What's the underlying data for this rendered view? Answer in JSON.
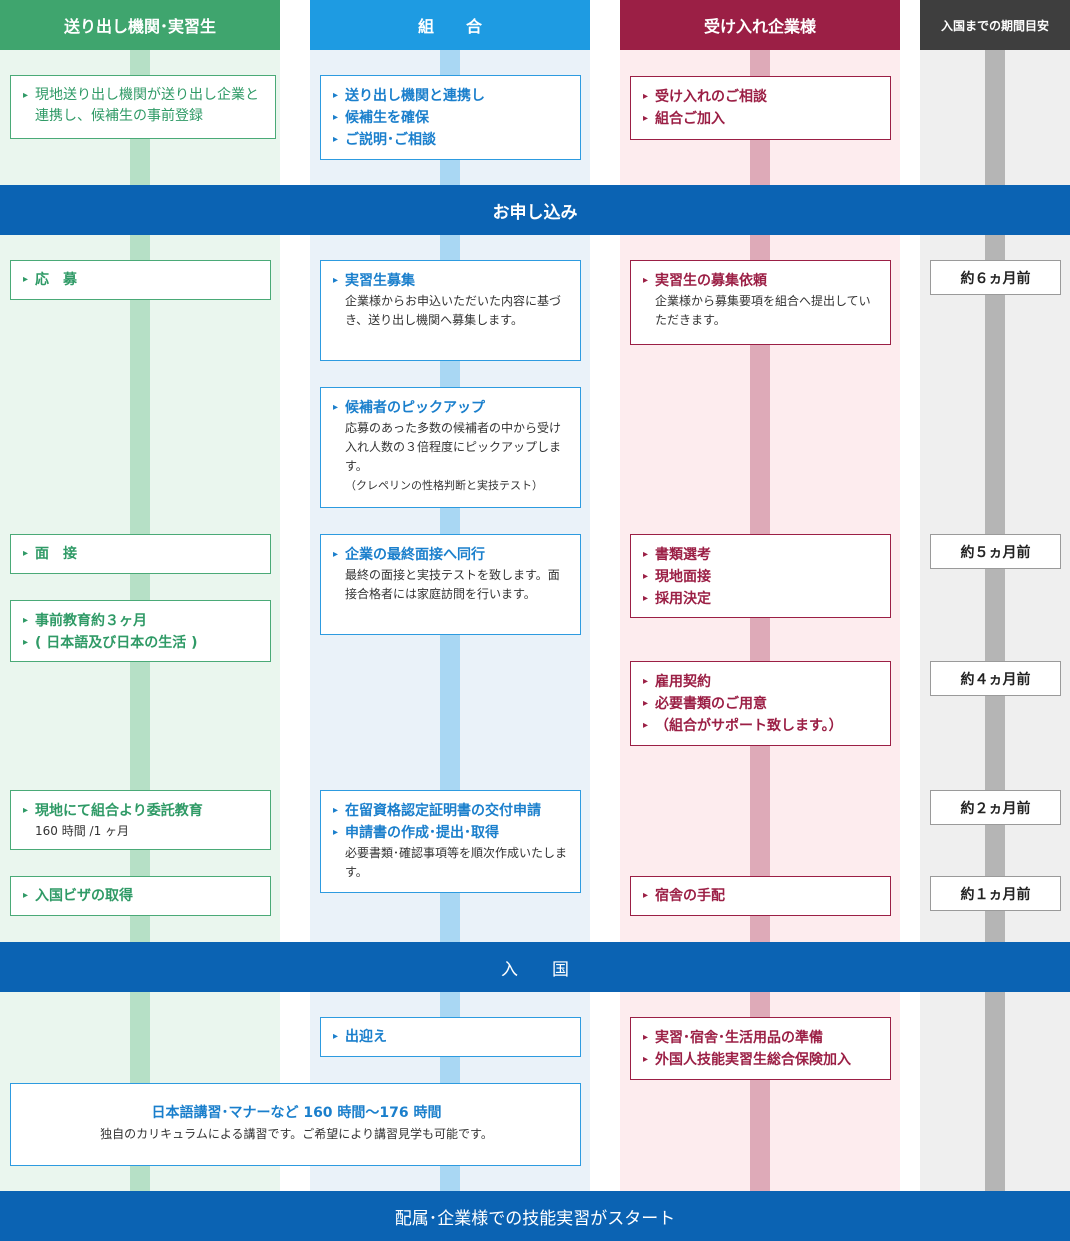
{
  "headers": {
    "sending": "送り出し機関･実習生",
    "union": "組　　合",
    "company": "受け入れ企業様",
    "period": "入国までの期間目安"
  },
  "colors": {
    "sending_header": "#3fa56e",
    "union_header": "#1e9be2",
    "company_header": "#9b1f45",
    "period_header": "#3e3e3e",
    "band": "#0b63b3"
  },
  "bands": {
    "apply": "お申し込み",
    "entry": "入　　国",
    "start": "配属･企業様での技能実習がスタート"
  },
  "sending": {
    "register": "現地送り出し機関が送り出し企業と連携し、候補生の事前登録",
    "apply": "応　募",
    "interview": "面　接",
    "pre_edu": "事前教育約３ヶ月",
    "pre_edu_sub": "( 日本語及び日本の生活 )",
    "local_edu": "現地にて組合より委託教育",
    "local_edu_sub": "160 時間 /1 ヶ月",
    "visa": "入国ビザの取得"
  },
  "union": {
    "pre1": "送り出し機関と連携し",
    "pre1b": "候補生を確保",
    "pre2": "ご説明･ご相談",
    "recruit": "実習生募集",
    "recruit_desc": "企業様からお申込いただいた内容に基づき、送り出し機関へ募集します。",
    "pickup": "候補者のピックアップ",
    "pickup_desc": "応募のあった多数の候補者の中から受け入れ人数の３倍程度にピックアップします。",
    "pickup_note": "（クレペリンの性格判断と実技テスト）",
    "final": "企業の最終面接へ同行",
    "final_desc": "最終の面接と実技テストを致します。面接合格者には家庭訪問を行います。",
    "cert1": "在留資格認定証明書の交付申請",
    "cert2": "申請書の作成･提出･取得",
    "cert_desc": "必要書類･確認事項等を順次作成いたします。",
    "pickup_arrival": "出迎え",
    "training": "日本語講習･マナーなど 160 時間〜176 時間",
    "training_desc": "独自のカリキュラムによる講習です。ご希望により講習見学も可能です。"
  },
  "company": {
    "consult": "受け入れのご相談",
    "join": "組合ご加入",
    "request": "実習生の募集依頼",
    "request_desc": "企業様から募集要項を組合へ提出していただきます。",
    "doc": "書類選考",
    "local": "現地面接",
    "decide": "採用決定",
    "contract": "雇用契約",
    "papers": "必要書類のご用意",
    "papers_sub": "（組合がサポート致します。）",
    "dorm": "宿舎の手配",
    "prep": "実習･宿舎･生活用品の準備",
    "insurance": "外国人技能実習生総合保険加入"
  },
  "period": {
    "m6": "約６ヵ月前",
    "m5": "約５ヵ月前",
    "m4": "約４ヵ月前",
    "m2": "約２ヵ月前",
    "m1": "約１ヵ月前"
  }
}
